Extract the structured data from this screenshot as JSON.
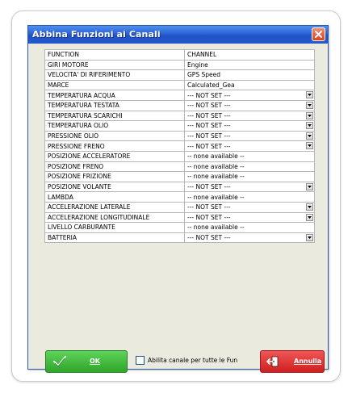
{
  "window": {
    "title": "Abbina Funzioni ai Canali"
  },
  "table": {
    "headers": {
      "function": "FUNCTION",
      "channel": "CHANNEL"
    },
    "rows": [
      {
        "function": "GIRI MOTORE",
        "channel": "Engine",
        "dropdown": false
      },
      {
        "function": "VELOCITA' DI RIFERIMENTO",
        "channel": "GPS Speed",
        "dropdown": false
      },
      {
        "function": "MARCE",
        "channel": "Calculated_Gea",
        "dropdown": false
      },
      {
        "function": "TEMPERATURA ACQUA",
        "channel": "--- NOT SET ---",
        "dropdown": true
      },
      {
        "function": "TEMPERATURA TESTATA",
        "channel": "--- NOT SET ---",
        "dropdown": true
      },
      {
        "function": "TEMPERATURA SCARICHI",
        "channel": "--- NOT SET ---",
        "dropdown": true
      },
      {
        "function": "TEMPERATURA OLIO",
        "channel": "--- NOT SET ---",
        "dropdown": true
      },
      {
        "function": "PRESSIONE OLIO",
        "channel": "--- NOT SET ---",
        "dropdown": true
      },
      {
        "function": "PRESSIONE FRENO",
        "channel": "--- NOT SET ---",
        "dropdown": true
      },
      {
        "function": "POSIZIONE ACCELERATORE",
        "channel": "-- none available --",
        "dropdown": false
      },
      {
        "function": "POSIZIONE FRENO",
        "channel": "-- none available --",
        "dropdown": false
      },
      {
        "function": "POSIZIONE FRIZIONE",
        "channel": "-- none available --",
        "dropdown": false
      },
      {
        "function": "POSIZIONE VOLANTE",
        "channel": "--- NOT SET ---",
        "dropdown": true
      },
      {
        "function": "LAMBDA",
        "channel": "-- none available --",
        "dropdown": false
      },
      {
        "function": "ACCELERAZIONE LATERALE",
        "channel": "--- NOT SET ---",
        "dropdown": true
      },
      {
        "function": "ACCELERAZIONE LONGITUDINALE",
        "channel": "--- NOT SET ---",
        "dropdown": true
      },
      {
        "function": "LIVELLO CARBURANTE",
        "channel": "-- none available --",
        "dropdown": false
      },
      {
        "function": "BATTERIA",
        "channel": "--- NOT SET ---",
        "dropdown": true
      }
    ]
  },
  "footer": {
    "ok_label": "OK",
    "checkbox_label": "Abilita canale per tutte le Fun",
    "checkbox_checked": false,
    "cancel_label": "Annulla"
  },
  "colors": {
    "titlebar": "#2a63d6",
    "window_bg": "#ebeadf",
    "ok_button": "#3cb838",
    "cancel_button": "#e03a3a"
  },
  "icons": {
    "close": "close-icon",
    "dropdown": "chevron-down-icon",
    "ok": "checkmark-icon",
    "cancel": "exit-door-icon"
  }
}
